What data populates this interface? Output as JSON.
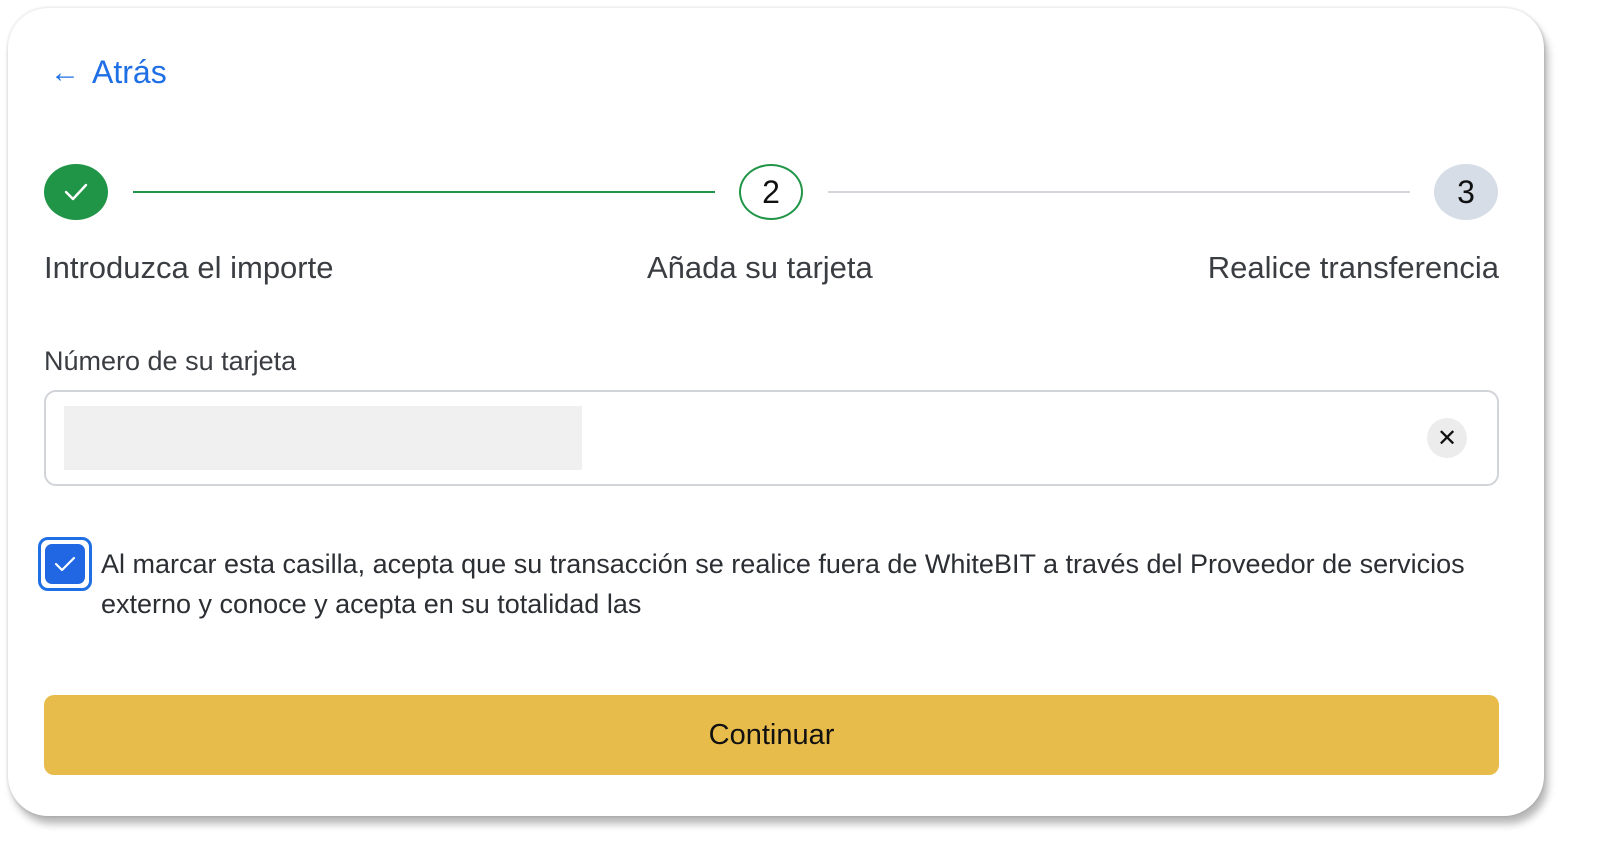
{
  "back": {
    "label": "Atrás",
    "icon": "arrow-left-icon"
  },
  "stepper": {
    "steps": [
      {
        "number": "",
        "label": "Introduzca el importe",
        "state": "completed",
        "icon": "check-icon"
      },
      {
        "number": "2",
        "label": "Añada su tarjeta",
        "state": "current"
      },
      {
        "number": "3",
        "label": "Realice transferencia",
        "state": "upcoming"
      }
    ]
  },
  "card_field": {
    "label": "Número de su tarjeta",
    "value": "",
    "clear_icon": "close-icon"
  },
  "consent": {
    "checked": true,
    "text": "Al marcar esta casilla, acepta que su transacción se realice fuera de WhiteBIT a través del Proveedor de servicios externo y conoce y acepta en su totalidad las"
  },
  "actions": {
    "continue_label": "Continuar"
  },
  "colors": {
    "accent_blue": "#1f6fe5",
    "step_green": "#219547",
    "upcoming_step": "#d6dde7",
    "button_yellow": "#e8bc4a"
  }
}
